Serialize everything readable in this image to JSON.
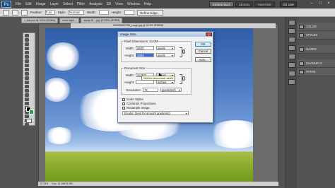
{
  "app": {
    "logo": "Ps"
  },
  "menu": [
    "File",
    "Edit",
    "Image",
    "Layer",
    "Select",
    "Filter",
    "Analysis",
    "3D",
    "View",
    "Window",
    "Help"
  ],
  "workspace_tabs": [
    {
      "label": "ESSENTIALS",
      "active": true
    },
    {
      "label": "DESIGN",
      "active": false
    },
    {
      "label": "PAINTING",
      "active": false
    }
  ],
  "cs_live": "CS Live",
  "window_controls": {
    "minimize": "–",
    "maximize": "□",
    "close": "×"
  },
  "options_bar": {
    "feather_label": "Feather:",
    "feather_value": "0 px",
    "style_label": "Style:",
    "style_value": "Normal",
    "width_label": "Width:",
    "height_label": "Height:",
    "refine": "Refine Edge..."
  },
  "doc_tabs": [
    "1_lost.psd @ 100% (RGB/8)",
    "mark hight ...",
    "sandy f6 ... jpg @ 100% (RGB/8)"
  ],
  "canvas": {
    "title": "000000001755_Large.jpg @ 33.3% (RGB/8)"
  },
  "status_bar": {
    "zoom": "33.33%",
    "doc": "Doc: 21.0M/21.0M"
  },
  "right_panels": {
    "group1": [
      {
        "label": "COLOR"
      },
      {
        "label": "STYLES"
      }
    ],
    "group2": [
      {
        "label": "MASKS"
      }
    ],
    "group3": [
      {
        "label": "CHANNELS"
      },
      {
        "label": "PATHS"
      }
    ]
  },
  "dialog": {
    "title": "Image Size",
    "pixel_dimensions": "Pixel Dimensions: 21.0M",
    "width_label": "Width:",
    "width_value": "2500",
    "height_label": "Height:",
    "height_value": "2933",
    "pixel_unit": "pixels",
    "document_size_label": "Document Size:",
    "doc_width_value": "34.833",
    "doc_height_value": "",
    "doc_unit": "inches",
    "resolution_label": "Resolution:",
    "resolution_value": "72",
    "resolution_unit": "pixels/inch",
    "scale_styles": "Scale Styles",
    "constrain_proportions": "Constrain Proportions",
    "resample_image": "Resample Image:",
    "resample_method": "Bicubic (best for smooth gradients)",
    "ok": "OK",
    "cancel": "Cancel",
    "auto": "Auto...",
    "close": "x",
    "tooltip": "Set the document width"
  }
}
